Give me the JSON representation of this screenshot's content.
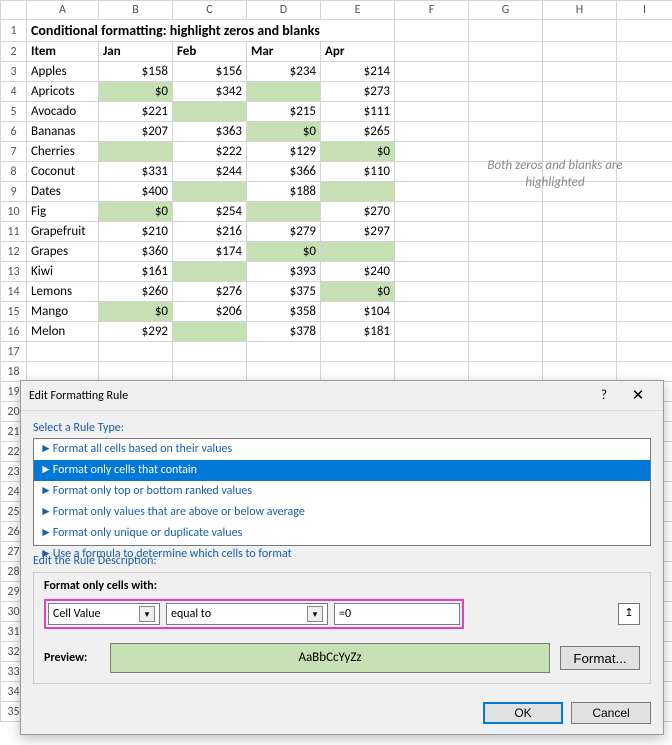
{
  "columns": [
    "",
    "A",
    "B",
    "C",
    "D",
    "E",
    "F",
    "G",
    "H",
    "I"
  ],
  "title": "Conditional formatting: highlight zeros and blanks",
  "headers": {
    "item": "Item",
    "jan": "Jan",
    "feb": "Feb",
    "mar": "Mar",
    "apr": "Apr"
  },
  "rows": [
    {
      "name": "Apples",
      "v": [
        "$158",
        "$156",
        "$234",
        "$214"
      ],
      "hl": [
        false,
        false,
        false,
        false
      ]
    },
    {
      "name": "Apricots",
      "v": [
        "$0",
        "$342",
        "",
        "$273"
      ],
      "hl": [
        true,
        false,
        true,
        false
      ]
    },
    {
      "name": "Avocado",
      "v": [
        "$221",
        "",
        "$215",
        "$111"
      ],
      "hl": [
        false,
        true,
        false,
        false
      ]
    },
    {
      "name": "Bananas",
      "v": [
        "$207",
        "$363",
        "$0",
        "$265"
      ],
      "hl": [
        false,
        false,
        true,
        false
      ]
    },
    {
      "name": "Cherries",
      "v": [
        "",
        "$222",
        "$129",
        "$0"
      ],
      "hl": [
        true,
        false,
        false,
        true
      ]
    },
    {
      "name": "Coconut",
      "v": [
        "$331",
        "$244",
        "$366",
        "$110"
      ],
      "hl": [
        false,
        false,
        false,
        false
      ]
    },
    {
      "name": "Dates",
      "v": [
        "$400",
        "",
        "$188",
        ""
      ],
      "hl": [
        false,
        true,
        false,
        true
      ]
    },
    {
      "name": "Fig",
      "v": [
        "$0",
        "$254",
        "",
        "$270"
      ],
      "hl": [
        true,
        false,
        true,
        false
      ]
    },
    {
      "name": "Grapefruit",
      "v": [
        "$210",
        "$216",
        "$279",
        "$297"
      ],
      "hl": [
        false,
        false,
        false,
        false
      ]
    },
    {
      "name": "Grapes",
      "v": [
        "$360",
        "$174",
        "$0",
        ""
      ],
      "hl": [
        false,
        false,
        true,
        true
      ]
    },
    {
      "name": "Kiwi",
      "v": [
        "$161",
        "",
        "$393",
        "$240"
      ],
      "hl": [
        false,
        true,
        false,
        false
      ]
    },
    {
      "name": "Lemons",
      "v": [
        "$260",
        "$276",
        "$375",
        "$0"
      ],
      "hl": [
        false,
        false,
        false,
        true
      ]
    },
    {
      "name": "Mango",
      "v": [
        "$0",
        "$206",
        "$358",
        "$104"
      ],
      "hl": [
        true,
        false,
        false,
        false
      ]
    },
    {
      "name": "Melon",
      "v": [
        "$292",
        "",
        "$378",
        "$181"
      ],
      "hl": [
        false,
        true,
        false,
        false
      ]
    }
  ],
  "annotation": "Both zeros and blanks are highlighted",
  "dialog": {
    "title": "Edit Formatting Rule",
    "select_label": "Select a Rule Type:",
    "rules": [
      "Format all cells based on their values",
      "Format only cells that contain",
      "Format only top or bottom ranked values",
      "Format only values that are above or below average",
      "Format only unique or duplicate values",
      "Use a formula to determine which cells to format"
    ],
    "selected_rule_index": 1,
    "edit_label": "Edit the Rule Description:",
    "desc_heading": "Format only cells with:",
    "combo1": "Cell Value",
    "combo2": "equal to",
    "value": "=0",
    "preview_label": "Preview:",
    "preview_text": "AaBbCcYyZz",
    "format_btn": "Format...",
    "ok": "OK",
    "cancel": "Cancel"
  }
}
